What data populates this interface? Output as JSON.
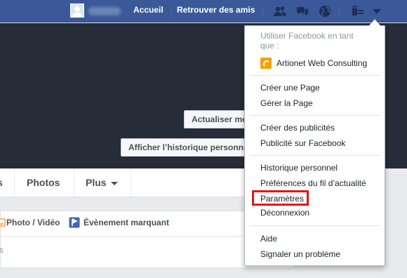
{
  "topbar": {
    "home_label": "Accueil",
    "find_friends_label": "Retrouver des amis",
    "icons": [
      "friend-requests-icon",
      "messages-icon",
      "notifications-globe-icon",
      "privacy-shortcuts-icon",
      "account-menu-chevron-icon"
    ]
  },
  "cover": {
    "update_button": "Actualiser mes",
    "history_button": "Afficher l’historique personnel"
  },
  "tabs": {
    "partial_tab": "s",
    "photos": "Photos",
    "more": "Plus"
  },
  "composer": {
    "photo_video": "Photo / Vidéo",
    "life_event": "Évènement marquant",
    "partial_text": "s"
  },
  "menu": {
    "use_as_line1": "Utiliser Facebook en tant",
    "use_as_line2": "que :",
    "page_name": "Artionet Web Consulting",
    "create_page": "Créer une Page",
    "manage_page": "Gérer la Page",
    "create_ads": "Créer des publicités",
    "advertising": "Publicité sur Facebook",
    "activity_log": "Historique personnel",
    "news_feed_prefs": "Préférences du fil d’actualité",
    "settings": "Paramètres",
    "logout": "Déconnexion",
    "help": "Aide",
    "report_problem": "Signaler un problème"
  },
  "colors": {
    "brand_blue": "#3b5998",
    "cover_dark": "#262c38",
    "highlight_red": "#e4161b",
    "page_icon_orange": "#f6a10d"
  }
}
